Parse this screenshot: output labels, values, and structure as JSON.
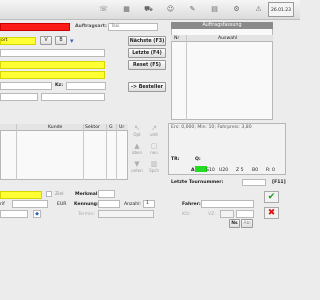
{
  "toolbar": {
    "clock": "26.01.23"
  },
  "form": {
    "auftragsart_label": "Auftragsart:",
    "auftragsart_value": "Taxi",
    "field_art_suffix": "ort",
    "btn_v": "V",
    "btn_b": "B",
    "kz_label": "Kz:",
    "bestellen_label": "-> Besteller"
  },
  "buttons": {
    "naechste": "Nächste (F3)",
    "letzte": "Letzte (F4)",
    "reset": "Reset (F5)"
  },
  "auftragsfassung": {
    "header": "Auftragsfassung",
    "col_nr": "Nr",
    "col_auswahl": "Auswahl"
  },
  "table": {
    "col_kunde": "Kunde",
    "col_sektor": "Sektor",
    "col_g": "G",
    "col_u": "Ur"
  },
  "nav": {
    "opt": "Opt",
    "umt": "umt",
    "oben": "oben",
    "neu": "neu",
    "unten": "unten",
    "spur": "Spch"
  },
  "info": {
    "line": "Ers: 0,000; Min: 10; Fahrpreis: 3,80",
    "tr_label": "TR:",
    "q_label": "Q:",
    "a_label": "A",
    "seg_s10": "S10",
    "seg_u20": "U20",
    "seg_z5": "Z 5",
    "seg_b0": "B0",
    "seg_r0": "R: 0",
    "letzte_tour": "Letzte Tournummer:",
    "f11": "[F11]"
  },
  "bottom": {
    "ziel_label": "Ziel",
    "merkmal_label": "Merkmal:",
    "eur_label": "EUR",
    "kennung_label": "Kennung:",
    "anzahl_label": "Anzahl:",
    "anzahl_value": "1",
    "termin_label": "Termin:",
    "fahrer_label": "Fahrer:",
    "kfz_label": "Kfz:",
    "vz_label": "VZ:",
    "ns_label": "Ns",
    "abl_label": "Abl",
    "left_prefix": "rif"
  },
  "colors": {
    "red": "#ff1a1a",
    "yellow": "#ffff33",
    "ok": "#1a9a1a",
    "cancel": "#d81818"
  }
}
